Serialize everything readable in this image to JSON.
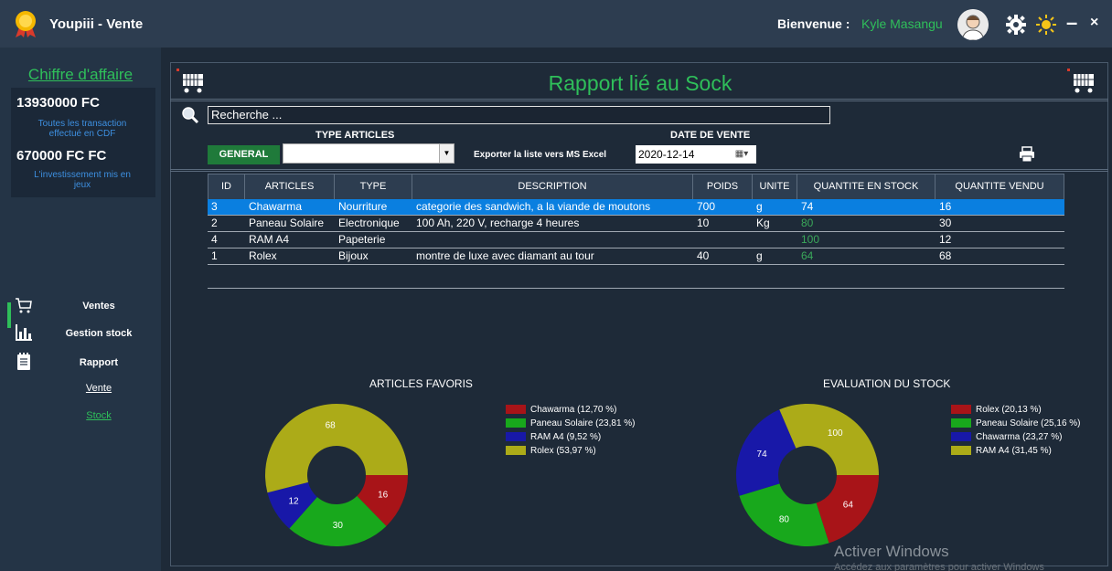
{
  "app": {
    "title": "Youpiii - Vente"
  },
  "header": {
    "welcome": "Bienvenue :",
    "username": "Kyle Masangu",
    "minimize": "–",
    "close": "×"
  },
  "sidebar": {
    "ca_title": "Chiffre d'affaire",
    "amount_cdf": "13930000  FC",
    "note_cdf": "Toutes les transaction effectué en CDF",
    "amount_invest": "670000 FC  FC",
    "note_invest": "L'investissement mis en jeux",
    "nav": [
      {
        "label": "Ventes",
        "icon": "cart-icon"
      },
      {
        "label": "Gestion stock",
        "icon": "bar-chart-icon"
      },
      {
        "label": "Rapport",
        "icon": "notepad-icon"
      }
    ],
    "sub_nav": [
      {
        "label": "Vente",
        "color": "#ffffff"
      },
      {
        "label": "Stock",
        "color": "#2fbf5a"
      }
    ]
  },
  "main": {
    "title": "Rapport lié au Sock",
    "search": {
      "value": "Recherche ..."
    },
    "filters": {
      "type_label": "TYPE ARTICLES",
      "date_label": "DATE DE VENTE",
      "general_button": "GENERAL",
      "type_value": "",
      "export_label": "Exporter la liste vers MS Excel",
      "date_value": "2020-12-14"
    },
    "table": {
      "columns": [
        "ID",
        "ARTICLES",
        "TYPE",
        "DESCRIPTION",
        "POIDS",
        "UNITE",
        "QUANTITE EN STOCK",
        "QUANTITE VENDU"
      ],
      "rows": [
        [
          "3",
          "Chawarma",
          "Nourriture",
          "categorie des sandwich, a la viande de moutons",
          "700",
          "g",
          "74",
          "16"
        ],
        [
          "2",
          "Paneau Solaire",
          "Electronique",
          "100 Ah, 220 V, recharge 4 heures",
          "10",
          "Kg",
          "80",
          "30"
        ],
        [
          "4",
          "RAM A4",
          "Papeterie",
          "",
          "",
          "",
          "100",
          "12"
        ],
        [
          "1",
          "Rolex",
          "Bijoux",
          "montre de luxe avec diamant au tour",
          "40",
          "g",
          "64",
          "68"
        ]
      ]
    }
  },
  "chart_data": [
    {
      "type": "pie",
      "title": "ARTICLES FAVORIS",
      "categories": [
        "Chawarma",
        "Paneau Solaire",
        "RAM A4",
        "Rolex"
      ],
      "values": [
        16,
        30,
        12,
        68
      ],
      "legend": [
        "Chawarma (12,70 %)",
        "Paneau Solaire (23,81 %)",
        "RAM A4 (9,52 %)",
        "Rolex (53,97 %)"
      ],
      "colors": [
        "#a81418",
        "#18a81c",
        "#1818a8",
        "#acab18"
      ],
      "legend_position": "right"
    },
    {
      "type": "pie",
      "title": "EVALUATION DU STOCK",
      "categories": [
        "Rolex",
        "Paneau Solaire",
        "Chawarma",
        "RAM A4"
      ],
      "values": [
        64,
        80,
        74,
        100
      ],
      "legend": [
        "Rolex (20,13 %)",
        "Paneau Solaire (25,16 %)",
        "Chawarma (23,27 %)",
        "RAM A4 (31,45 %)"
      ],
      "colors": [
        "#a81418",
        "#18a81c",
        "#1818a8",
        "#acab18"
      ],
      "legend_position": "right"
    }
  ],
  "watermark": {
    "line1": "Activer Windows",
    "line2": "Accédez aux paramètres pour activer Windows"
  }
}
